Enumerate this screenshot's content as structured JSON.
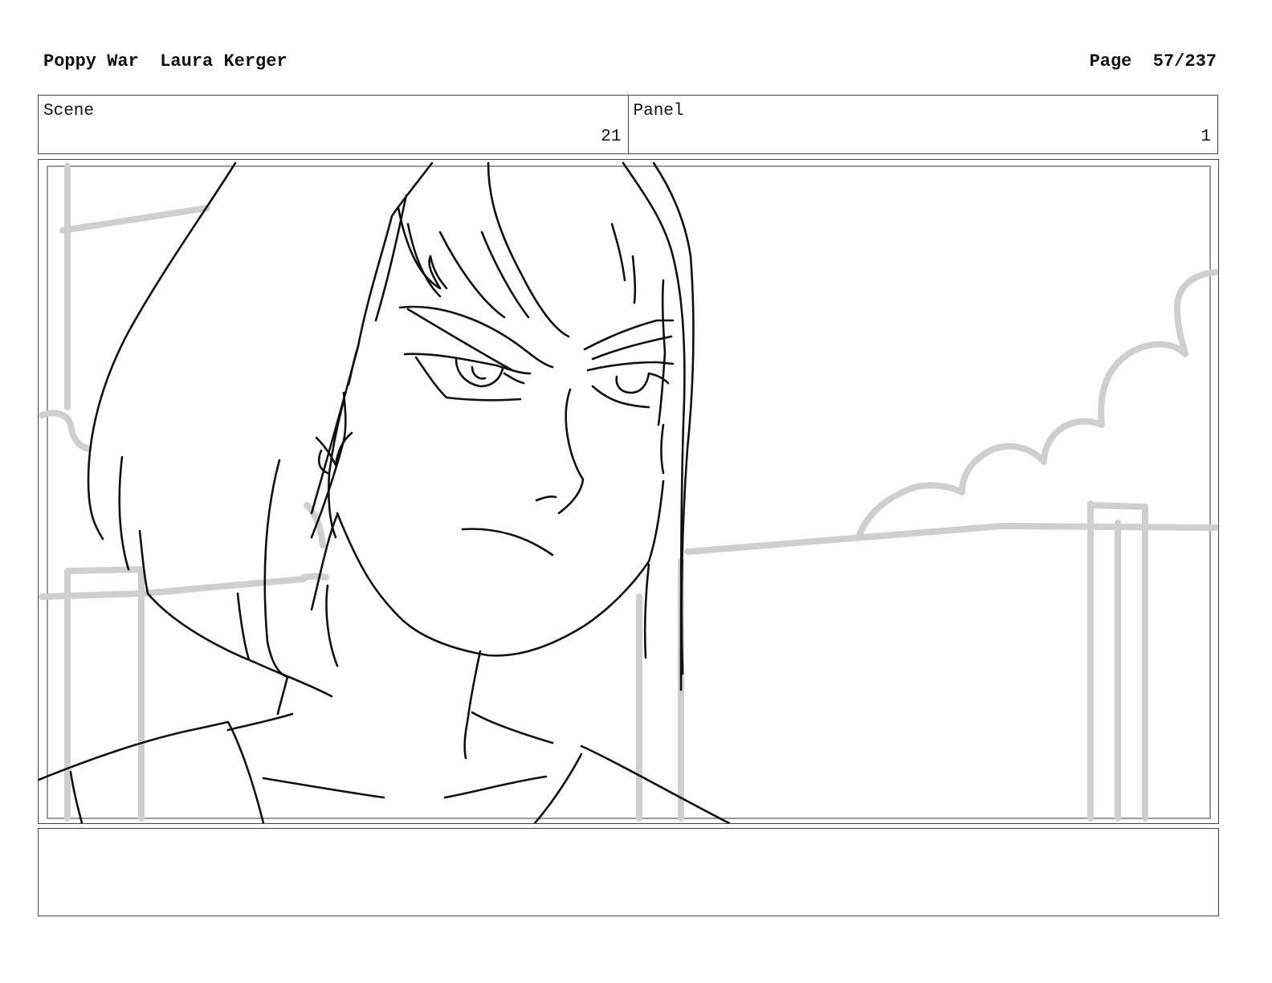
{
  "header": {
    "project": "Poppy War",
    "artist": "Laura Kerger",
    "page_label": "Page",
    "page_number": "57/237"
  },
  "info": {
    "scene_label": "Scene",
    "scene_value": "21",
    "panel_label": "Panel",
    "panel_value": "1"
  },
  "notes": {
    "text": ""
  },
  "colors": {
    "line": "#111111",
    "background_sketch": "#cfcfcf",
    "border": "#444444"
  }
}
